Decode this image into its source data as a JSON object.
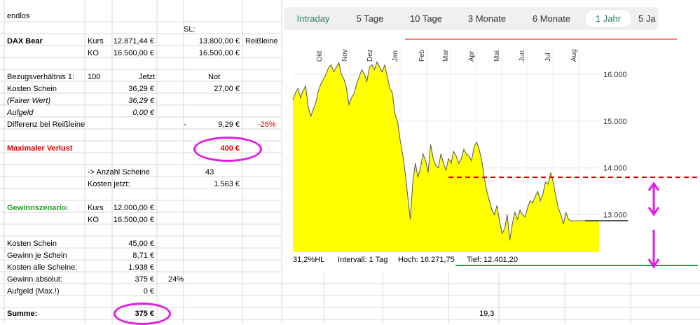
{
  "sheet": {
    "title": "endlos",
    "sl_label": "SL:",
    "product": "DAX Bear",
    "kurs_label": "Kurs",
    "kurs_value": "12.871,44 €",
    "ko_label": "KO",
    "ko_value": "16.500,00 €",
    "sl_value": "13.800,00 €",
    "reissleine_label": "Reißleine",
    "sl_ko_value": "16.500,00 €",
    "bezugsverhaeltnis_label": "Bezugsverhältnis 1:",
    "bezugsverhaeltnis_value": "100",
    "jetzt_label": "Jetzt",
    "not_label": "Not",
    "kosten_schein_label": "Kosten Schein",
    "kosten_schein_jetzt": "36,29 €",
    "kosten_schein_not": "27,00 €",
    "fairer_wert_label": "(Fairer Wert)",
    "fairer_wert_value": "36,29 €",
    "aufgeld_label": "Aufgeld",
    "aufgeld_value": "0,00 €",
    "differenz_label": "Differenz bei Reißleine",
    "differenz_dash": "-",
    "differenz_value": "9,29 €",
    "differenz_pct": "-26%",
    "max_verlust_label": "Maximaler Verlust",
    "max_verlust_value": "400 €",
    "anzahl_label": "-> Anzahl Scheine",
    "anzahl_value": "43",
    "kosten_jetzt_label": "Kosten jetzt:",
    "kosten_jetzt_value": "1.563 €",
    "gewinnszenario_label": "Gewinnszenario:",
    "gs_kurs_label": "Kurs",
    "gs_kurs_value": "12.000,00 €",
    "gs_ko_label": "KO",
    "gs_ko_value": "16.500,00 €",
    "gs_kosten_schein_label": "Kosten Schein",
    "gs_kosten_schein_value": "45,00 €",
    "gewinn_je_schein_label": "Gewinn je Schein",
    "gewinn_je_schein_value": "8,71 €",
    "kosten_alle_label": "Kosten alle Scheine:",
    "kosten_alle_value": "1.938 €",
    "gewinn_absolut_label": "Gewinn absolut:",
    "gewinn_absolut_value": "375 €",
    "gewinn_absolut_pct": "24%",
    "aufgeld_max_label": "Aufgeld (Max.!)",
    "aufgeld_max_value": "0 €",
    "summe_label": "Summe:",
    "summe_value": "375 €",
    "extra_value": "19,3"
  },
  "tabs": [
    {
      "label": "Intraday"
    },
    {
      "label": "5 Tage"
    },
    {
      "label": "10 Tage"
    },
    {
      "label": "3 Monate"
    },
    {
      "label": "6 Monate"
    },
    {
      "label": "1 Jahr"
    },
    {
      "label": "5 Ja"
    }
  ],
  "active_tab": "1 Jahr",
  "chart_footer": {
    "left": "31,2%HL",
    "interval": "Intervall: 1 Tag",
    "hoch": "Hoch:  16.271,75",
    "tief": "Tief:  12.401,20"
  },
  "colors": {
    "area_fill": "#ffff00",
    "line": "#555555",
    "stop_line": "#e00000",
    "green_line": "#1aa34a",
    "marker": "#e41be3"
  },
  "chart_data": {
    "type": "area",
    "x_ticks": [
      "Okt",
      "Nov",
      "Dez",
      "Jan",
      "Feb",
      "Mar",
      "Apr",
      "Mai",
      "Jun",
      "Jul",
      "Aug"
    ],
    "y_ticks": [
      "16.000",
      "15.000",
      "14.000",
      "13.000"
    ],
    "ylim": [
      12200,
      16600
    ],
    "grid": true,
    "x": [
      0,
      3,
      6,
      9,
      12,
      15,
      18,
      21,
      24,
      27,
      30,
      33,
      36,
      39,
      42,
      45,
      48,
      51,
      54,
      57,
      60,
      63,
      66,
      69,
      72,
      75,
      78,
      81,
      84,
      87,
      90,
      93,
      96,
      99,
      102,
      105,
      108,
      111,
      114,
      117,
      120,
      123,
      126,
      129,
      132,
      135,
      138,
      141,
      144,
      147,
      150,
      153,
      156,
      159,
      162,
      165,
      168,
      171,
      174,
      177,
      180,
      183,
      186,
      189,
      192,
      195,
      198,
      201,
      204,
      207,
      210,
      213,
      216,
      219,
      222,
      225,
      228,
      231,
      234,
      237,
      240,
      243,
      246,
      249,
      252,
      255,
      258,
      261,
      264,
      267,
      270,
      273,
      276,
      279,
      282,
      285,
      288,
      291,
      294,
      297,
      300,
      303,
      306,
      309,
      312,
      315,
      318,
      321,
      324,
      327,
      330,
      333,
      336,
      339,
      342,
      345,
      348,
      351,
      354,
      357,
      360
    ],
    "y": [
      15450,
      15600,
      15700,
      15500,
      15650,
      15750,
      15300,
      15100,
      15250,
      15400,
      15650,
      15800,
      15900,
      16000,
      16150,
      16200,
      16050,
      16150,
      16250,
      16000,
      15900,
      15700,
      15350,
      15500,
      15600,
      15800,
      15950,
      16100,
      16000,
      15850,
      16150,
      16200,
      16100,
      16270,
      16150,
      16050,
      16200,
      15950,
      15700,
      15600,
      15150,
      15000,
      14600,
      14300,
      13900,
      13400,
      12900,
      13700,
      14100,
      13800,
      14000,
      14300,
      14150,
      13900,
      14500,
      14200,
      14050,
      14000,
      14300,
      14100,
      13950,
      14200,
      14100,
      14350,
      14250,
      14100,
      14200,
      14400,
      14300,
      14250,
      14150,
      14450,
      14550,
      14400,
      14150,
      13800,
      13500,
      13300,
      13100,
      13000,
      13200,
      12850,
      12600,
      12700,
      13000,
      12450,
      12800,
      13050,
      12900,
      13100,
      13000,
      12950,
      13150,
      13300,
      13250,
      13400,
      13500,
      13300,
      13450,
      13700,
      13650,
      13900,
      13700,
      13400,
      13150,
      13000,
      12800,
      13050,
      12900,
      12870,
      12870,
      12870,
      12870,
      12870,
      12870,
      12870,
      12870,
      12870,
      12870,
      12870,
      12870
    ],
    "sl_level": 13800
  }
}
